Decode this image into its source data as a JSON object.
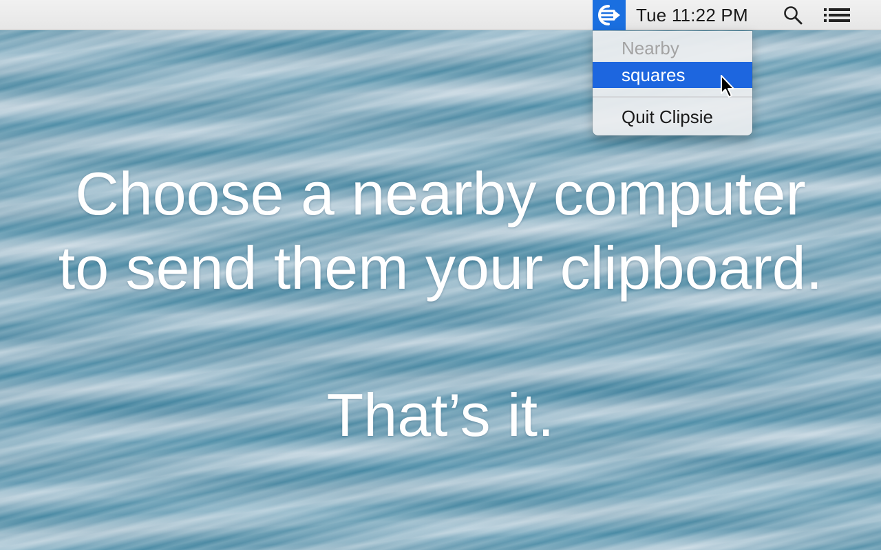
{
  "menubar": {
    "app_icon": "clipsie-share-arrow-icon",
    "clock": "Tue 11:22 PM",
    "search_icon": "search-icon",
    "list_icon": "notification-list-icon",
    "accent_color": "#1a6fe0"
  },
  "menu": {
    "header": "Nearby",
    "items": [
      {
        "label": "squares",
        "highlighted": true
      }
    ],
    "quit_label": "Quit Clipsie",
    "highlight_color": "#1d66df"
  },
  "main": {
    "line1": "Choose a nearby computer",
    "line2": "to send them your clipboard.",
    "line3": "That’s it."
  }
}
